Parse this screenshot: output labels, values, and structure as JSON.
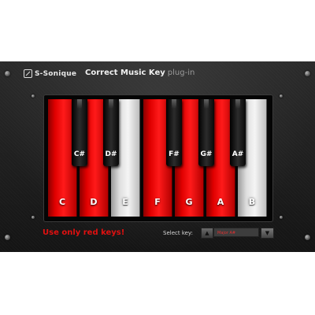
{
  "header": {
    "brand": "S-Sonique",
    "title": "Correct Music Key",
    "subtitle": "plug-in"
  },
  "keyboard": {
    "white_keys": [
      {
        "label": "C",
        "color": "red"
      },
      {
        "label": "D",
        "color": "red"
      },
      {
        "label": "E",
        "color": "white"
      },
      {
        "label": "F",
        "color": "red"
      },
      {
        "label": "G",
        "color": "red"
      },
      {
        "label": "A",
        "color": "red"
      },
      {
        "label": "B",
        "color": "white"
      }
    ],
    "black_keys": [
      {
        "label": "C#"
      },
      {
        "label": "D#"
      },
      {
        "label": "F#"
      },
      {
        "label": "G#"
      },
      {
        "label": "A#"
      }
    ]
  },
  "footer": {
    "message": "Use only red keys!",
    "select_label": "Select key:",
    "selected_key": "Major A#",
    "prev_icon": "triangle-up-icon",
    "next_icon": "triangle-down-icon"
  },
  "colors": {
    "red_key": "#e00000",
    "white_key": "#e6e6e6",
    "message": "#e01010",
    "panel": "#1c1c1c"
  }
}
